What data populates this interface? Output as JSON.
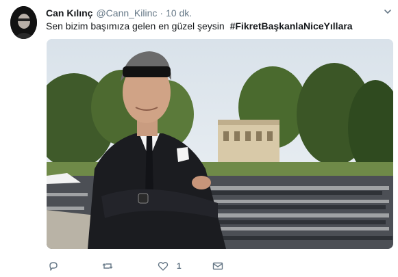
{
  "tweet": {
    "author_name": "Can Kılınç",
    "handle": "@Cann_Kilinc",
    "separator": "·",
    "time": "10 dk.",
    "text": "Sen bizim başımıza gelen en güzel şeysin",
    "hashtag": "#FikretBaşkanlaNiceYıllara"
  },
  "actions": {
    "reply_count": "",
    "retweet_count": "",
    "like_count": "1",
    "dm_count": ""
  },
  "icons": {
    "menu": "chevron-down-icon",
    "reply": "reply-icon",
    "retweet": "retweet-icon",
    "like": "heart-icon",
    "dm": "envelope-icon"
  },
  "colors": {
    "secondary_text": "#657786",
    "primary_text": "#14171a",
    "icon": "#657786"
  }
}
